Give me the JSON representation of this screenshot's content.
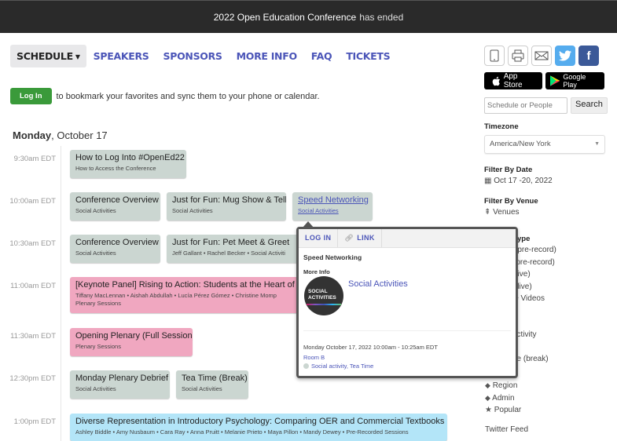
{
  "banner": {
    "event_name": "2022 Open Education Conference",
    "status": "has ended"
  },
  "nav": {
    "items": [
      {
        "label": "SCHEDULE",
        "active": true,
        "has_dropdown": true
      },
      {
        "label": "SPEAKERS"
      },
      {
        "label": "SPONSORS"
      },
      {
        "label": "MORE INFO"
      },
      {
        "label": "FAQ"
      },
      {
        "label": "TICKETS"
      }
    ]
  },
  "login_bar": {
    "button_label": "Log In",
    "message": "to bookmark your favorites and sync them to your phone or calendar."
  },
  "day": {
    "weekday": "Monday",
    "date": ", October 17"
  },
  "schedule": [
    {
      "time": "9:30am EDT",
      "events": [
        {
          "title": "How to Log Into #OpenEd22",
          "subtitle": "How to Access the Conference",
          "color": "gray"
        }
      ]
    },
    {
      "time": "10:00am EDT",
      "events": [
        {
          "title": "Conference Overview",
          "subtitle": "Social Activities",
          "color": "gray"
        },
        {
          "title": "Just for Fun: Mug Show & Tell",
          "subtitle": "Social Activities",
          "color": "gray"
        },
        {
          "title": "Speed Networking",
          "subtitle": "Social Activities",
          "color": "gray",
          "hovered": true
        }
      ]
    },
    {
      "time": "10:30am EDT",
      "events": [
        {
          "title": "Conference Overview",
          "subtitle": "Social Activities",
          "color": "gray"
        },
        {
          "title": "Just for Fun: Pet Meet & Greet",
          "subtitle": "Jeff Gallant • Rachel Becker • Social Activiti",
          "color": "gray"
        }
      ]
    },
    {
      "time": "11:00am EDT",
      "events": [
        {
          "title": "[Keynote Panel] Rising to Action: Students at the Heart of Op",
          "subtitle": "Tiffany MacLennan • Aishah Abdullah • Lucía Pérez Gómez • Christine Momp",
          "subtitle2": "Plenary Sessions",
          "color": "pink"
        }
      ]
    },
    {
      "time": "11:30am EDT",
      "events": [
        {
          "title": "Opening Plenary (Full Session)",
          "subtitle": "Plenary Sessions",
          "color": "pink"
        }
      ]
    },
    {
      "time": "12:30pm EDT",
      "events": [
        {
          "title": "Monday Plenary Debrief",
          "subtitle": "Social Activities",
          "color": "gray"
        },
        {
          "title": "Tea Time (Break)",
          "subtitle": "Social Activities",
          "color": "gray"
        }
      ]
    },
    {
      "time": "1:00pm EDT",
      "events": [
        {
          "title": "Diverse Representation in Introductory Psychology: Comparing OER and Commercial Textbooks",
          "subtitle": "Ashley Biddle • Amy Nusbaum • Cara Ray • Anna Pruitt • Melanie Prieto • Maya Pillon • Mandy Dewey • Pre-Recorded Sessions",
          "color": "blue"
        }
      ]
    }
  ],
  "popup": {
    "tabs": [
      "LOG IN",
      "LINK"
    ],
    "title": "Speed Networking",
    "more_info_label": "More Info",
    "avatar_text_1": "SOCIAL",
    "avatar_text_2": "ACTIVITIES",
    "category": "Social Activities",
    "when": "Monday October 17, 2022 10:00am - 10:25am EDT",
    "room": "Room B",
    "tags": "Social activity, Tea Time"
  },
  "sidebar": {
    "share_icons": [
      "mobile-icon",
      "print-icon",
      "email-icon",
      "twitter-icon",
      "facebook-icon"
    ],
    "app_store_label": "App Store",
    "google_play_label": "Google Play",
    "search_placeholder": "Schedule or People",
    "search_button": "Search",
    "timezone_label": "Timezone",
    "timezone_value": "America/New York",
    "filter_date_label": "Filter By Date",
    "filter_date_value": "Oct 17 -20, 2022",
    "filter_venue_label": "Filter By Venue",
    "filter_venue_value": "Venues",
    "type_label_partial": "ype",
    "type_items_partial": [
      "(pre-record)",
      "(pre-record)",
      "(live)",
      "(live)",
      "le Videos",
      "y",
      "",
      "activity",
      "rt",
      "ne (break)"
    ],
    "extra_filters": [
      "Region",
      "Admin",
      "Popular"
    ],
    "twitter_feed_label": "Twitter Feed"
  },
  "colors": {
    "accent": "#4b55b8",
    "login_green": "#3a9a3a",
    "event_gray": "#cbd6d1",
    "event_pink": "#f0a7c0",
    "event_blue": "#b3e5f8",
    "banner_bg": "#2a2a2a"
  }
}
